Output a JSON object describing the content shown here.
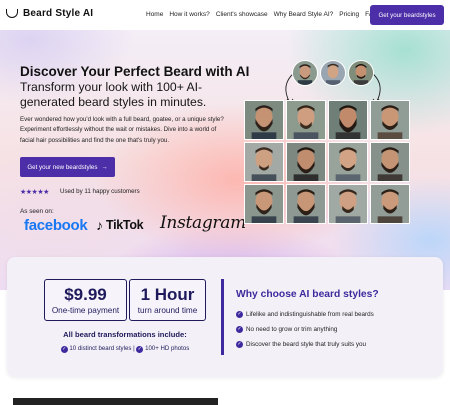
{
  "brand": {
    "name": "Beard Style AI"
  },
  "nav": {
    "links": [
      "Home",
      "How it works?",
      "Client's showcase",
      "Why Beard Style AI?",
      "Pricing",
      "FAQ"
    ],
    "cta": "Get your beardstyles"
  },
  "hero": {
    "title": "Discover Your Perfect Beard with AI",
    "subtitle": "Transform your look with 100+ AI-generated beard styles in minutes.",
    "description": "Ever wondered how you'd look with a full beard, goatee, or a unique style? Experiment effortlessly without the wait or mistakes. Dive into a world of facial hair possibilities and find the one that's truly you.",
    "cta": "Get your new beardstyles",
    "cta_arrow": "→",
    "stars": "★★★★★",
    "social_proof": "Used by 11 happy customers",
    "seen_on": "As seen on:",
    "press": {
      "facebook": "facebook",
      "tiktok": "TikTok",
      "instagram": "Instagram"
    }
  },
  "pricing": {
    "price": "$9.99",
    "price_label": "One-time payment",
    "turnaround": "1 Hour",
    "turnaround_label": "turn around time",
    "includes_title": "All beard transformations include:",
    "includes_1": "10 distinct beard styles",
    "separator": "|",
    "includes_2": "100+ HD photos",
    "why_title": "Why choose AI beard styles?",
    "features": [
      "Lifelike and indistinguishable from real beards",
      "No need to grow or trim anything",
      "Discover the beard style that truly suits you"
    ]
  },
  "colors": {
    "accent": "#4b2ea8",
    "navy": "#1f1a5c",
    "facebook": "#1877f2"
  },
  "icons": {
    "logo": "beard-logo-icon",
    "arrow": "arrow-right-icon",
    "check": "check-circle-icon",
    "tiktok": "tiktok-note-icon"
  }
}
